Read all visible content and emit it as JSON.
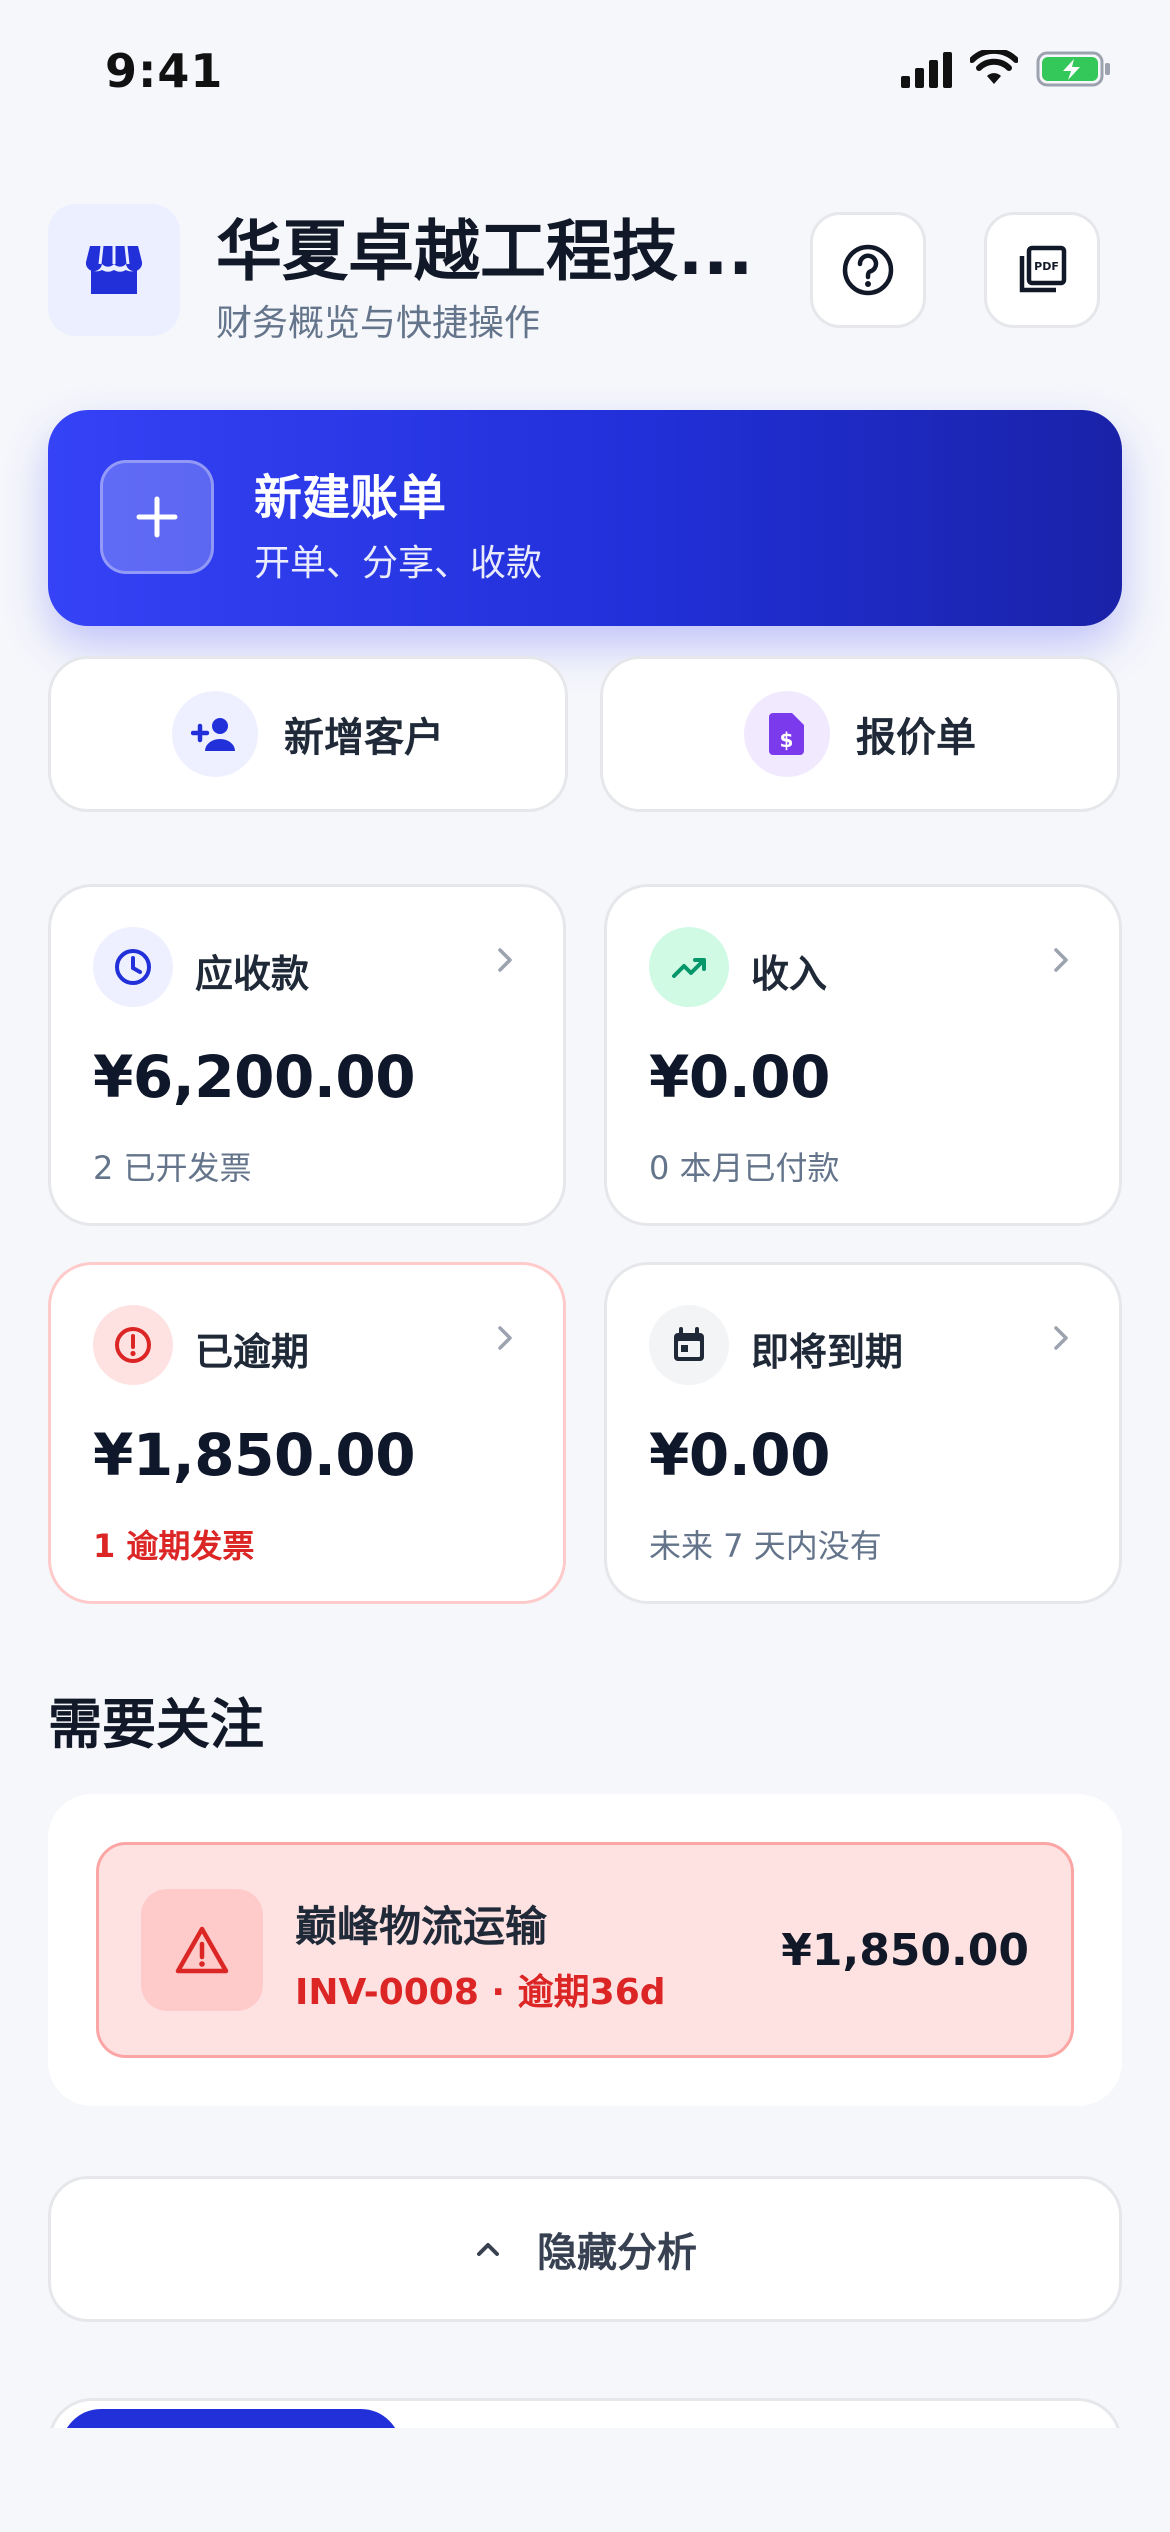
{
  "status_bar": {
    "time": "9:41"
  },
  "header": {
    "company_name": "华夏卓越工程技...",
    "subtitle": "财务概览与快捷操作"
  },
  "primary_action": {
    "title": "新建账单",
    "subtitle": "开单、分享、收款"
  },
  "secondary_actions": [
    {
      "label": "新增客户",
      "icon": "add-user-icon"
    },
    {
      "label": "报价单",
      "icon": "dollar-document-icon"
    }
  ],
  "stats": [
    {
      "title": "应收款",
      "amount": "¥6,200.00",
      "sub": "2 已开发票",
      "icon": "clock-icon"
    },
    {
      "title": "收入",
      "amount": "¥0.00",
      "sub": "0 本月已付款",
      "icon": "trending-up-icon"
    },
    {
      "title": "已逾期",
      "amount": "¥1,850.00",
      "sub": "1 逾期发票",
      "icon": "alert-circle-icon"
    },
    {
      "title": "即将到期",
      "amount": "¥0.00",
      "sub": "未来 7 天内没有",
      "icon": "calendar-icon"
    }
  ],
  "attention": {
    "title": "需要关注",
    "items": [
      {
        "name": "巅峰物流运输",
        "meta": "INV-0008 · 逾期36d",
        "amount": "¥1,850.00"
      }
    ]
  },
  "toggle": {
    "label": "隐藏分析"
  },
  "colors": {
    "accent": "#2130d9",
    "danger": "#dc2626",
    "success": "#10b981",
    "background": "#f6f7fb"
  }
}
